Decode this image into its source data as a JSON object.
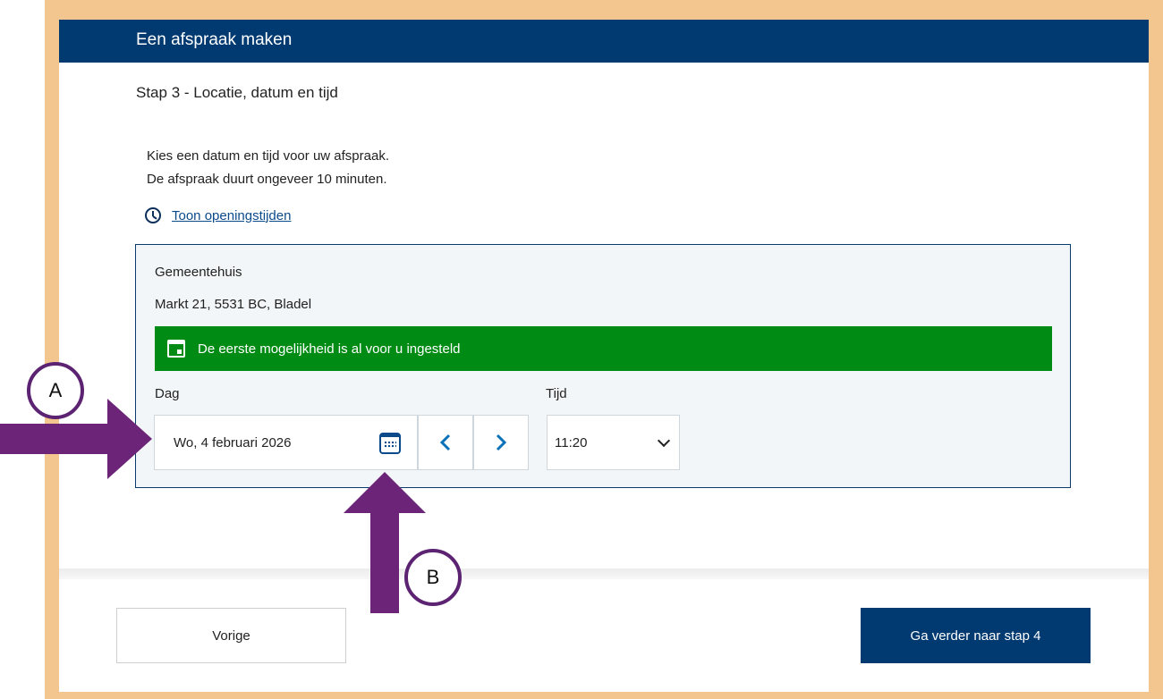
{
  "header": {
    "title": "Een afspraak maken"
  },
  "step": {
    "title": "Stap 3 - Locatie, datum en tijd"
  },
  "intro": {
    "line1": "Kies een datum en tijd voor uw afspraak.",
    "line2": "De afspraak duurt ongeveer 10 minuten."
  },
  "opening_hours_link": "Toon openingstijden",
  "location": {
    "name": "Gemeentehuis",
    "address": "Markt 21, 5531 BC, Bladel"
  },
  "banner": {
    "text": "De eerste mogelijkheid is al voor u ingesteld",
    "color": "#008c14"
  },
  "date": {
    "label": "Dag",
    "value": "Wo, 4 februari 2026",
    "prev_icon": "chevron-left-icon",
    "next_icon": "chevron-right-icon",
    "calendar_icon": "calendar-icon"
  },
  "time": {
    "label": "Tijd",
    "value": "11:20"
  },
  "footer": {
    "prev_label": "Vorige",
    "next_label": "Ga verder naar stap 4"
  },
  "annotations": {
    "marker_a": "A",
    "marker_b": "B",
    "color": "#6b2478"
  },
  "colors": {
    "brand": "#003a70",
    "frame": "#f3c58f"
  }
}
